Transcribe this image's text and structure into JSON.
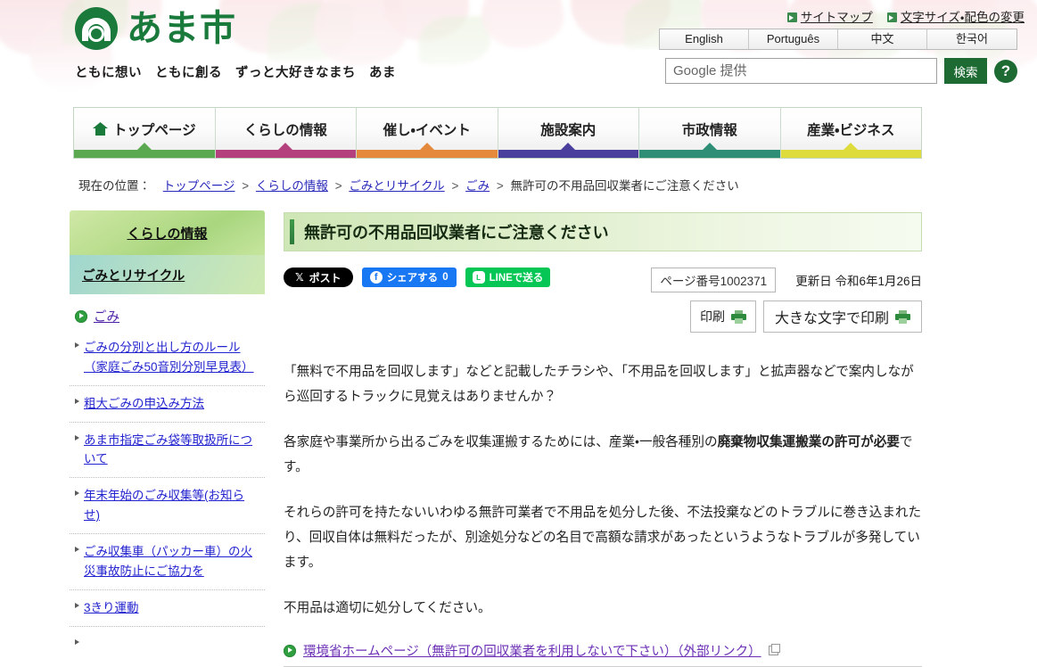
{
  "site": {
    "logo_text": "あま市",
    "logo_icon": "ama-city-logo-icon",
    "tagline": "ともに想い　ともに創る　ずっと大好きなまち　あま"
  },
  "utility": {
    "links": [
      {
        "label": "サイトマップ",
        "icon": "arrow-square-icon"
      },
      {
        "label": "文字サイズ・配色の変更",
        "icon": "arrow-square-icon"
      }
    ]
  },
  "languages": [
    "English",
    "Português",
    "中文",
    "한국어"
  ],
  "search": {
    "placeholder": "Google 提供",
    "value": "",
    "button_label": "検索",
    "help_label": "?"
  },
  "gnav": [
    {
      "label": "トップページ",
      "color": "#5aa84f",
      "icon": "home-icon"
    },
    {
      "label": "くらしの情報",
      "color": "#b4407e"
    },
    {
      "label": "催し・イベント",
      "color": "#e58a3c"
    },
    {
      "label": "施設案内",
      "color": "#4b3f9e"
    },
    {
      "label": "市政情報",
      "color": "#2f8f76"
    },
    {
      "label": "産業・ビジネス",
      "color": "#dedb3c"
    }
  ],
  "breadcrumb": {
    "label": "現在の位置：",
    "items": [
      {
        "text": "トップページ",
        "link": true
      },
      {
        "text": "くらしの情報",
        "link": true
      },
      {
        "text": "ごみとリサイクル",
        "link": true
      },
      {
        "text": "ごみ",
        "link": true
      },
      {
        "text": "無許可の不用品回収業者にご注意ください",
        "link": false
      }
    ],
    "separator": ">"
  },
  "sidebar": {
    "primary_heading": "くらしの情報",
    "secondary_heading": "ごみとリサイクル",
    "top_link": "ごみ",
    "items": [
      "ごみの分別と出し方のルール（家庭ごみ50音別分別早見表）",
      "粗大ごみの申込み方法",
      "あま市指定ごみ袋等取扱所について",
      "年末年始のごみ収集等(お知らせ)",
      "ごみ収集車（パッカー車）の火災事故防止にご協力を",
      "3きり運動"
    ]
  },
  "main": {
    "title": "無許可の不用品回収業者にご注意ください",
    "share": {
      "x_label": "ポスト",
      "x_glyph": "𝕏",
      "facebook_label": "シェアする",
      "facebook_count": "0",
      "facebook_glyph": "f",
      "line_label": "LINEで送る",
      "line_glyph": "LINE"
    },
    "page_number": "ページ番号1002371",
    "updated": "更新日 令和6年1月26日",
    "print_label": "印刷",
    "print_large_label": "大きな文字で印刷",
    "paragraphs": [
      {
        "runs": [
          {
            "text": "「無料で不用品を回収します」などと記載したチラシや、「不用品を回収します」と拡声器などで案内しながら巡回するトラックに見覚えはありませんか？",
            "bold": false
          }
        ]
      },
      {
        "runs": [
          {
            "text": "各家庭や事業所から出るごみを収集運搬するためには、産業・一般各種別の",
            "bold": false
          },
          {
            "text": "廃棄物収集運搬業の許可が必要",
            "bold": true
          },
          {
            "text": "です。",
            "bold": false
          }
        ]
      },
      {
        "runs": [
          {
            "text": "それらの許可を持たないいわゆる無許可業者で不用品を処分した後、不法投棄などのトラブルに巻き込まれたり、回収自体は無料だったが、別途処分などの名目で高額な請求があったというようなトラブルが多発しています。",
            "bold": false
          }
        ]
      },
      {
        "runs": [
          {
            "text": "不用品は適切に処分してください。",
            "bold": false
          }
        ]
      }
    ],
    "external_link": {
      "text": "環境省ホームページ（無許可の回収業者を利用しないで下さい）（外部リンク）",
      "icon": "green-arrow-circle-icon",
      "new_window_icon": "new-window-icon"
    }
  }
}
